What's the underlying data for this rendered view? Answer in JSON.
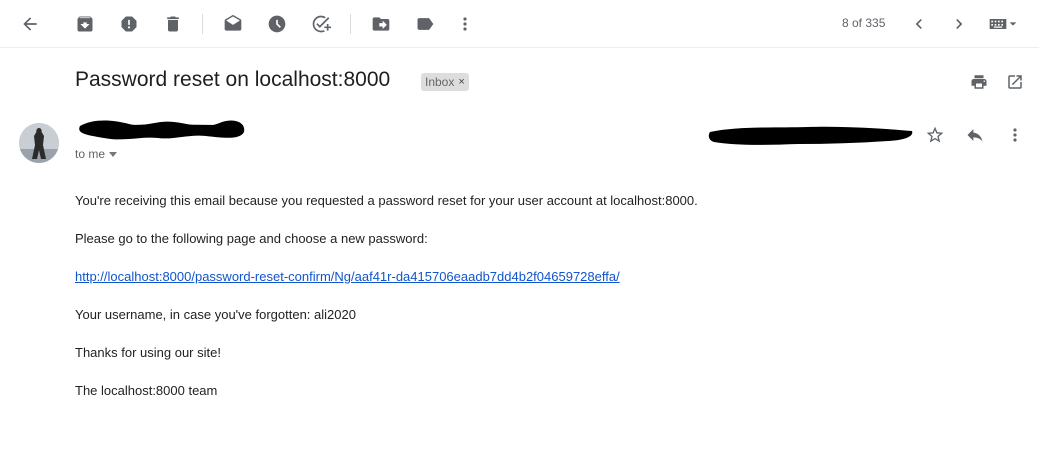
{
  "toolbar": {
    "icons": [
      "back-arrow-icon",
      "archive-icon",
      "report-spam-icon",
      "delete-icon",
      "mark-unread-icon",
      "snooze-icon",
      "add-to-tasks-icon",
      "move-to-icon",
      "label-icon",
      "more-vert-icon"
    ],
    "pager": "8 of 335",
    "input_tools": "keyboard-icon"
  },
  "email": {
    "subject": "Password reset on localhost:8000",
    "label": "Inbox",
    "label_remove": "×",
    "to": "to me",
    "body": {
      "line1": "You're receiving this email because you requested a password reset for your user account at localhost:8000.",
      "line2": "Please go to the following page and choose a new password:",
      "link": "http://localhost:8000/password-reset-confirm/Ng/aaf41r-da415706eaadb7dd4b2f04659728effa/",
      "line3": "Your username, in case you've forgotten: ali2020",
      "line4": "Thanks for using our site!",
      "line5": "The localhost:8000 team"
    }
  },
  "colors": {
    "link": "#1155cc",
    "icon": "#5f6368",
    "chip_bg": "#dddddd"
  }
}
